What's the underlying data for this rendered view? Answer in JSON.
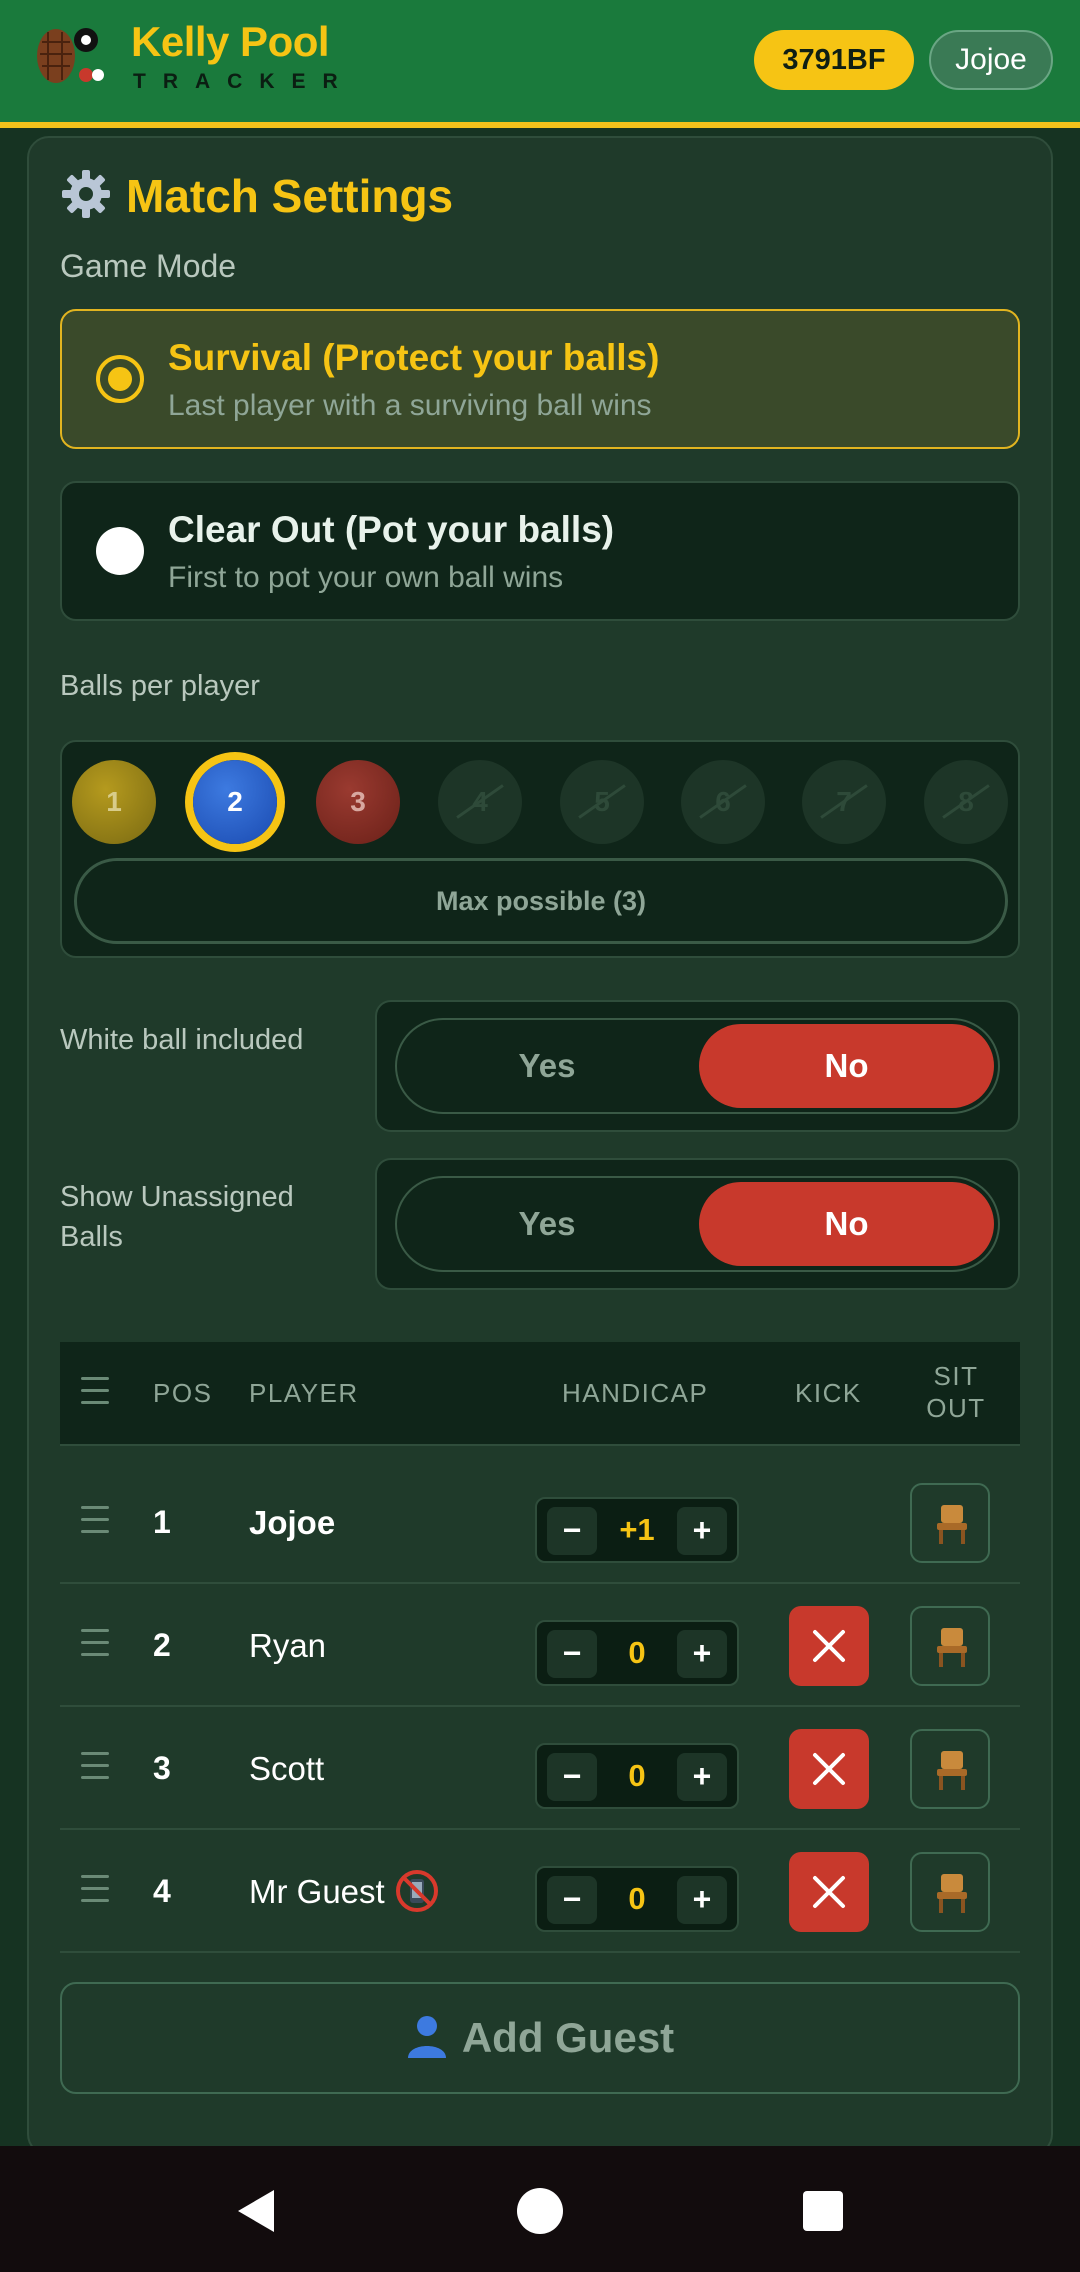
{
  "header": {
    "title": "Kelly Pool",
    "subtitle": "TRACKER",
    "room_code": "3791BF",
    "user": "Jojoe"
  },
  "settings": {
    "title": "Match Settings",
    "game_mode_label": "Game Mode",
    "modes": [
      {
        "title": "Survival (Protect your balls)",
        "desc": "Last player with a surviving ball wins",
        "selected": true
      },
      {
        "title": "Clear Out (Pot your balls)",
        "desc": "First to pot your own ball wins",
        "selected": false
      }
    ],
    "balls_label": "Balls per player",
    "balls": [
      "1",
      "2",
      "3",
      "4",
      "5",
      "6",
      "7",
      "8"
    ],
    "balls_selected": "2",
    "balls_max_available": 3,
    "max_button": "Max possible (3)",
    "white_ball": {
      "label": "White ball included",
      "yes": "Yes",
      "no": "No",
      "value": "No"
    },
    "unassigned": {
      "label": "Show Unassigned Balls",
      "yes": "Yes",
      "no": "No",
      "value": "No"
    }
  },
  "table": {
    "headers": {
      "pos": "POS",
      "player": "PLAYER",
      "handicap": "HANDICAP",
      "kick": "KICK",
      "sit_out": "SIT OUT"
    },
    "rows": [
      {
        "pos": "1",
        "name": "Jojoe",
        "handicap": "+1",
        "kickable": false
      },
      {
        "pos": "2",
        "name": "Ryan",
        "handicap": "0",
        "kickable": true
      },
      {
        "pos": "3",
        "name": "Scott",
        "handicap": "0",
        "kickable": true
      },
      {
        "pos": "4",
        "name": "Mr Guest",
        "handicap": "0",
        "kickable": true,
        "icon": "no-phone-icon"
      }
    ],
    "minus": "−",
    "plus": "+"
  },
  "add_guest": "Add Guest",
  "colors": {
    "header_green": "#1a7a3c",
    "accent_yellow": "#f6c414",
    "danger_red": "#c8392c",
    "background": "#163322"
  }
}
